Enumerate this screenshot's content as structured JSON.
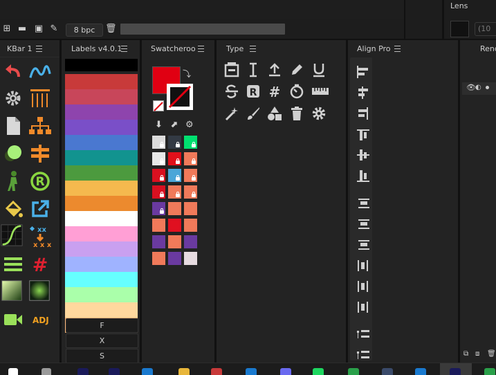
{
  "toolbar": {
    "bpc_label": "8 bpc"
  },
  "lens": {
    "title": "Lens",
    "field_value": "(10"
  },
  "panels": {
    "kbar": {
      "title": "KBar 1",
      "adj_label": "ADJ"
    },
    "labels": {
      "title": "Labels v4.0.1",
      "colors": [
        "#000000",
        "#c83a3a",
        "#c8465a",
        "#8e44ad",
        "#7a4fc8",
        "#4a78d0",
        "#12938f",
        "#4c9a3e",
        "#f5b94e",
        "#ec8a2e",
        "#ffffff",
        "#ff9fd5",
        "#c9a0f0",
        "#9fb3ff",
        "#66ffff",
        "#aaffaa",
        "#ffd89e",
        "#ffb87a"
      ],
      "buttons": [
        "F",
        "X",
        "S"
      ]
    },
    "swatcheroo": {
      "title": "Swatcheroo",
      "fill_color": "#e00012",
      "grid": [
        [
          "#dcdcdc",
          "#333a44",
          "#00e070"
        ],
        [
          "#e8e8e8",
          "#e0101a",
          "#f07a5a"
        ],
        [
          "#d81020",
          "#4aa6d8",
          "#f07a5a"
        ],
        [
          "#d81020",
          "#f07a5a",
          "#f07a5a"
        ],
        [
          "#6a3aa0",
          "#f07a5a",
          "#f07a5a"
        ],
        [
          "#f07a5a",
          "#e01020",
          "#f07a5a"
        ],
        [
          "#6a3aa0",
          "#f07a5a",
          "#6a3aa0"
        ],
        [
          "#f07a5a",
          "#6a3aa0",
          "#e6dbe0"
        ]
      ],
      "locked": [
        [
          1,
          1,
          1
        ],
        [
          1,
          1,
          1
        ],
        [
          1,
          1,
          1
        ],
        [
          1,
          1,
          1
        ],
        [
          1,
          0,
          0
        ],
        [
          0,
          0,
          0
        ],
        [
          0,
          0,
          0
        ],
        [
          0,
          0,
          0
        ]
      ]
    },
    "type": {
      "title": "Type"
    },
    "align": {
      "title": "Align Pro"
    },
    "render": {
      "title": "Rend"
    }
  }
}
